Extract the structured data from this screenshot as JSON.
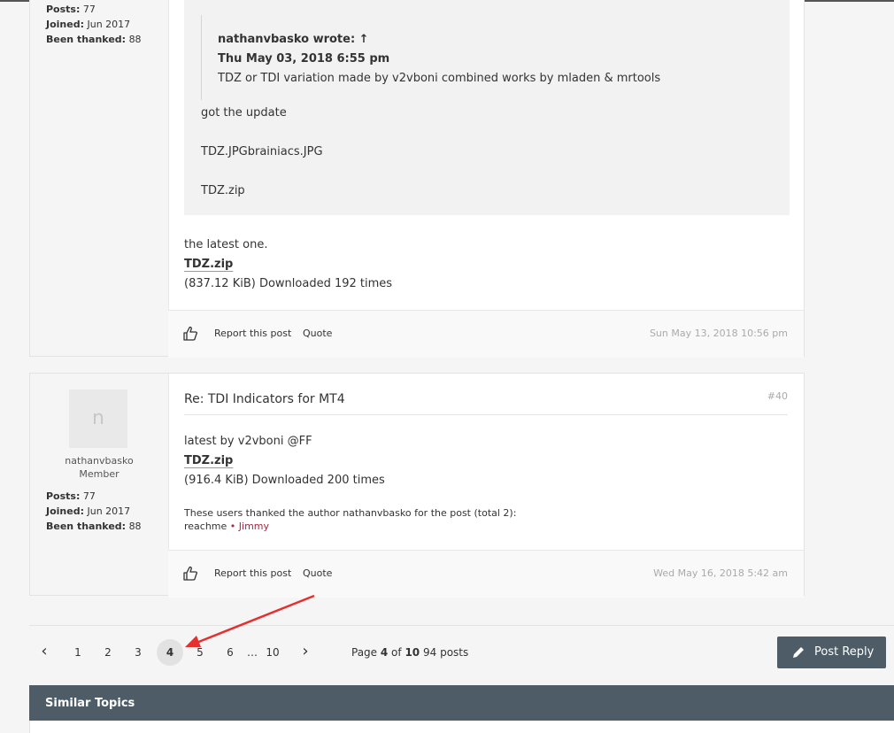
{
  "post1": {
    "author_stats": [
      {
        "label": "Posts:",
        "value": "77"
      },
      {
        "label": "Joined:",
        "value": "Jun 2017"
      },
      {
        "label": "Been thanked:",
        "value": "88"
      }
    ],
    "quote": {
      "author_line": "nathanvbasko wrote: ↑",
      "date": "Thu May 03, 2018 6:55 pm",
      "text": "TDZ or TDI variation made by v2vboni combined works by mladen & mrtools",
      "lines": [
        "got the update",
        "TDZ.JPGbrainiacs.JPG",
        "TDZ.zip"
      ]
    },
    "body_text": "the latest one.",
    "attachment_name": "TDZ.zip",
    "attachment_info": "(837.12 KiB) Downloaded 192 times",
    "report_label": "Report this post",
    "quote_label": "Quote",
    "timestamp": "Sun May 13, 2018 10:56 pm"
  },
  "post2": {
    "avatar_letter": "n",
    "username": "nathanvbasko",
    "rank": "Member",
    "author_stats": [
      {
        "label": "Posts:",
        "value": "77"
      },
      {
        "label": "Joined:",
        "value": "Jun 2017"
      },
      {
        "label": "Been thanked:",
        "value": "88"
      }
    ],
    "title": "Re: TDI Indicators for MT4",
    "post_number": "#40",
    "body_text": "latest by v2vboni @FF",
    "attachment_name": "TDZ.zip",
    "attachment_info": "(916.4 KiB) Downloaded 200 times",
    "thanks_text": "These users thanked the author nathanvbasko for the post (total 2):",
    "thanks_user1": "reachme",
    "thanks_sep": " • ",
    "thanks_user2": "Jimmy",
    "report_label": "Report this post",
    "quote_label": "Quote",
    "timestamp": "Wed May 16, 2018 5:42 am"
  },
  "pagination": {
    "prev": "‹",
    "pages": [
      "1",
      "2",
      "3"
    ],
    "current": "4",
    "pages_after": [
      "5",
      "6"
    ],
    "ellipsis": "…",
    "last": "10",
    "next": "›",
    "info_prefix": "Page ",
    "info_current": "4",
    "info_of": " of ",
    "info_total": "10",
    "post_count": "94 posts"
  },
  "post_reply_label": "Post Reply",
  "similar_topics_label": "Similar Topics",
  "colors": {
    "accent_dark": "#4d5c66",
    "thanks_link": "#a8263f",
    "annotation_arrow": "#e53030"
  },
  "icons": [
    "thumbs-up-icon",
    "pencil-icon",
    "chevron-left-icon",
    "chevron-right-icon",
    "annotation-arrow"
  ]
}
